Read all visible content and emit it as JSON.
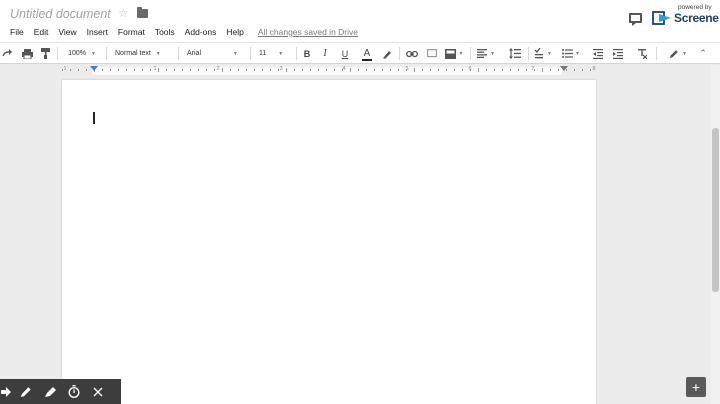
{
  "document": {
    "title": "Untitled document",
    "save_status": "All changes saved in Drive"
  },
  "menu": [
    "File",
    "Edit",
    "View",
    "Insert",
    "Format",
    "Tools",
    "Add-ons",
    "Help"
  ],
  "logo": {
    "tagline": "powered by",
    "name": "Screene"
  },
  "toolbar": {
    "zoom": "100%",
    "style": "Normal text",
    "font": "Arial",
    "font_size": "11",
    "bold_label": "B",
    "italic_label": "I",
    "underline_label": "U",
    "text_color_label": "A"
  },
  "ruler": {
    "numbers": [
      "1",
      "1",
      "2",
      "3",
      "4",
      "5",
      "6",
      "7",
      "8"
    ]
  },
  "icons": {
    "star": "star-icon",
    "folder": "folder-icon",
    "comment": "comment-icon",
    "add": "add-icon",
    "recorder_tools": [
      "pointer-icon",
      "pen-icon",
      "highlighter-icon",
      "timer-icon",
      "close-icon"
    ]
  },
  "colors": {
    "logo_text": "#1d3f6e",
    "indent_marker": "#4a7cc9",
    "recorder_bar": "#3d3d3d"
  }
}
